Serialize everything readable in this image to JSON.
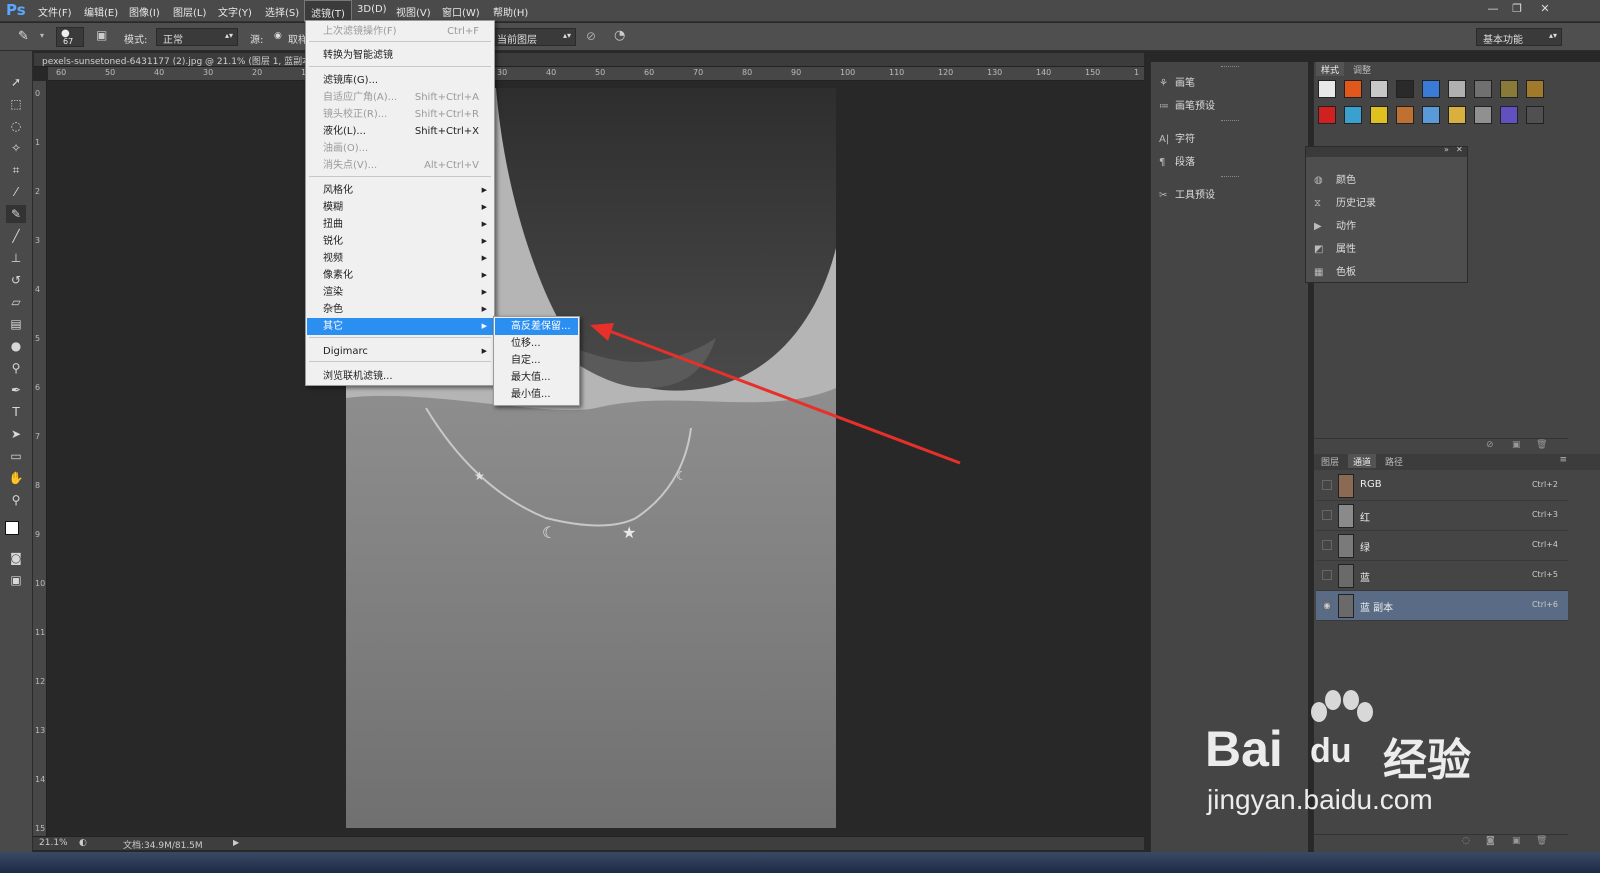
{
  "app": {
    "logo": "Ps",
    "menus": [
      "文件(F)",
      "编辑(E)",
      "图像(I)",
      "图层(L)",
      "文字(Y)",
      "选择(S)",
      "滤镜(T)",
      "3D(D)",
      "视图(V)",
      "窗口(W)",
      "帮助(H)"
    ],
    "window_controls": [
      "—",
      "❐",
      "✕"
    ]
  },
  "options_bar": {
    "brush_size": "67",
    "mode_label": "模式:",
    "mode_value": "正常",
    "source_label": "源:",
    "source_option": "取样",
    "sample_value": "当前图层",
    "workspace": "基本功能"
  },
  "document": {
    "tab_title": "pexels-sunsetoned-6431177 (2).jpg @ 21.1% (图层 1, 蓝副本/8)",
    "zoom": "21.1%",
    "doc_info": "文档:34.9M/81.5M",
    "hruler_ticks": [
      "60",
      "50",
      "40",
      "30",
      "20",
      "10",
      "0",
      "10",
      "20",
      "30",
      "40",
      "50",
      "60",
      "70",
      "80",
      "90",
      "100",
      "110",
      "120",
      "130",
      "140",
      "150",
      "1"
    ],
    "vruler_ticks": [
      "0",
      "1",
      "2",
      "3",
      "4",
      "5",
      "6",
      "7",
      "8",
      "9",
      "10",
      "11",
      "12",
      "13",
      "14",
      "15"
    ]
  },
  "filter_menu": {
    "items": [
      {
        "label": "上次滤镜操作(F)",
        "shortcut": "Ctrl+F",
        "disabled": true
      },
      {
        "label": "转换为智能滤镜",
        "shortcut": "",
        "disabled": false
      },
      {
        "label": "滤镜库(G)...",
        "shortcut": "",
        "disabled": false
      },
      {
        "label": "自适应广角(A)...",
        "shortcut": "Shift+Ctrl+A",
        "disabled": true
      },
      {
        "label": "镜头校正(R)...",
        "shortcut": "Shift+Ctrl+R",
        "disabled": true
      },
      {
        "label": "液化(L)...",
        "shortcut": "Shift+Ctrl+X",
        "disabled": false
      },
      {
        "label": "油画(O)...",
        "shortcut": "",
        "disabled": true
      },
      {
        "label": "消失点(V)...",
        "shortcut": "Alt+Ctrl+V",
        "disabled": true
      },
      {
        "label": "风格化",
        "shortcut": "",
        "disabled": false
      },
      {
        "label": "模糊",
        "shortcut": "",
        "disabled": false
      },
      {
        "label": "扭曲",
        "shortcut": "",
        "disabled": false
      },
      {
        "label": "锐化",
        "shortcut": "",
        "disabled": false
      },
      {
        "label": "视频",
        "shortcut": "",
        "disabled": false
      },
      {
        "label": "像素化",
        "shortcut": "",
        "disabled": false
      },
      {
        "label": "渲染",
        "shortcut": "",
        "disabled": false
      },
      {
        "label": "杂色",
        "shortcut": "",
        "disabled": false
      },
      {
        "label": "其它",
        "shortcut": "",
        "disabled": false
      },
      {
        "label": "Digimarc",
        "shortcut": "",
        "disabled": false
      },
      {
        "label": "浏览联机滤镜...",
        "shortcut": "",
        "disabled": false
      }
    ]
  },
  "other_submenu": {
    "items": [
      "高反差保留...",
      "位移...",
      "自定...",
      "最大值...",
      "最小值..."
    ]
  },
  "mid_panel": {
    "items": [
      "画笔",
      "画笔预设",
      "字符",
      "段落",
      "工具预设"
    ]
  },
  "styles_panel": {
    "tabs": [
      "样式",
      "调整"
    ],
    "swatch_colors": [
      "#e8e8e8",
      "#e0581c",
      "#c8c8c8",
      "#2a2a2a",
      "#3a7bd5",
      "#b0b0b0",
      "#707070",
      "#8a7a3a",
      "#a07a2a",
      "#d02020",
      "#3aa0d0",
      "#e0c020",
      "#c07030",
      "#5a9ad8",
      "#d8b040",
      "#909090",
      "#6050c0",
      "#505050"
    ]
  },
  "float_panel": {
    "items": [
      "颜色",
      "历史记录",
      "动作",
      "属性",
      "色板"
    ]
  },
  "channels_panel": {
    "tabs": [
      "图层",
      "通道",
      "路径"
    ],
    "rows": [
      {
        "name": "RGB",
        "shortcut": "Ctrl+2",
        "visible": false,
        "selected": false
      },
      {
        "name": "红",
        "shortcut": "Ctrl+3",
        "visible": false,
        "selected": false
      },
      {
        "name": "绿",
        "shortcut": "Ctrl+4",
        "visible": false,
        "selected": false
      },
      {
        "name": "蓝",
        "shortcut": "Ctrl+5",
        "visible": false,
        "selected": false
      },
      {
        "name": "蓝 副本",
        "shortcut": "Ctrl+6",
        "visible": true,
        "selected": true
      }
    ]
  },
  "watermark": {
    "brand": "Bai",
    "brand2": "du",
    "cn": "经验",
    "url": "jingyan.baidu.com"
  },
  "annotation": {
    "arrow_color": "#e8302a"
  }
}
